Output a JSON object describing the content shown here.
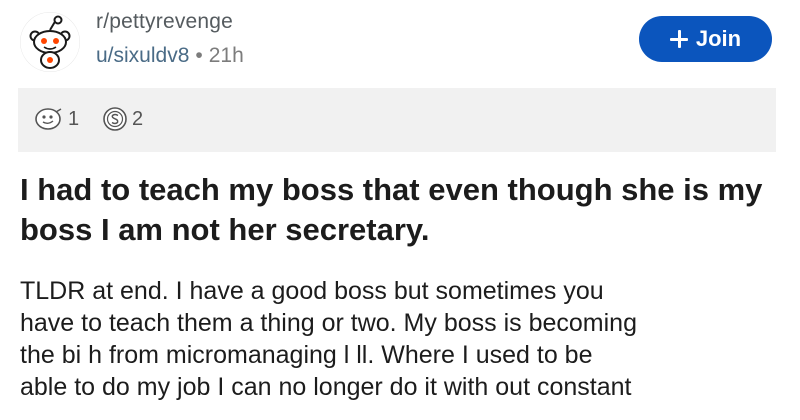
{
  "header": {
    "subreddit": "r/pettyrevenge",
    "username": "u/sixuldv8",
    "separator": "•",
    "age": "21h",
    "join_label": "Join"
  },
  "awards": [
    {
      "icon": "award-face-icon",
      "count": "1"
    },
    {
      "icon": "award-coin-icon",
      "count": "2"
    }
  ],
  "post": {
    "title": "I had to teach my boss that even though she is my boss I am not her secretary.",
    "body": "TLDR at end. I have a good boss but sometimes you\nhave to teach them a thing or two. My boss is becoming\nthe bi  h from micromanaging l   ll. Where I used to be\nable to do my job I can no longer do it with out constant"
  },
  "colors": {
    "join_button": "#0b55bd",
    "awards_bar": "#f1f1f1",
    "username": "#4a6b86"
  }
}
